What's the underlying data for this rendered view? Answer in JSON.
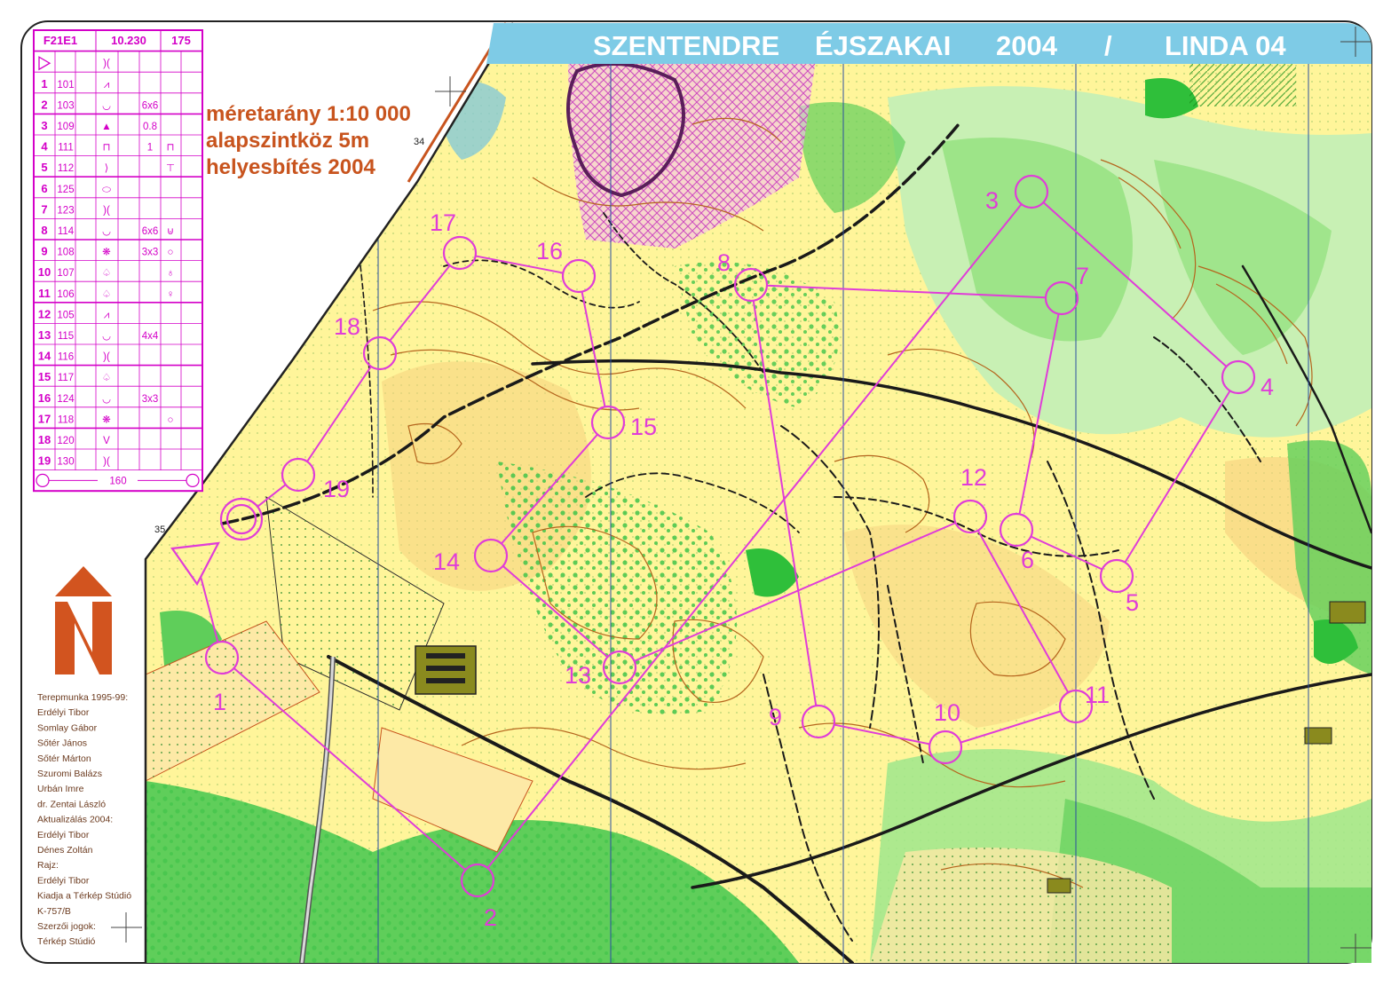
{
  "title": {
    "parts": [
      "SZENTENDRE",
      "ÉJSZAKAI",
      "2004",
      "/",
      "LINDA 04"
    ]
  },
  "map_info": {
    "scale": "méretarány 1:10 000",
    "contour": "alapszintköz 5m",
    "revision": "helyesbítés 2004"
  },
  "grid_labels": {
    "top": "34",
    "left": "35"
  },
  "colors": {
    "course": "#e03cd8",
    "title_bar": "#7ecbe6",
    "info_text": "#c8541e",
    "open_land": "#fff59a",
    "forest_green": "#5fce5a",
    "contour": "#b5651d",
    "north_arrow": "#d2541f"
  },
  "control_descriptions": {
    "header": [
      "F21E1",
      "10.230",
      "175"
    ],
    "start_symbol": "start-triangle",
    "start_feature": ")(",
    "rows": [
      {
        "num": "1",
        "code": "101",
        "feature": "⩘",
        "dim": "",
        "extra": ""
      },
      {
        "num": "2",
        "code": "103",
        "feature": "◡",
        "dim": "6x6",
        "extra": ""
      },
      {
        "num": "3",
        "code": "109",
        "feature": "▲",
        "dim": "0.8",
        "extra": ""
      },
      {
        "num": "4",
        "code": "111",
        "feature": "⊓",
        "dim": "1",
        "extra": "⊓"
      },
      {
        "num": "5",
        "code": "112",
        "feature": "⟩",
        "dim": "",
        "extra": "⊤"
      },
      {
        "num": "6",
        "code": "125",
        "feature": "⬭",
        "dim": "",
        "extra": ""
      },
      {
        "num": "7",
        "code": "123",
        "feature": ")(",
        "dim": "",
        "extra": ""
      },
      {
        "num": "8",
        "code": "114",
        "feature": "◡",
        "dim": "6x6",
        "extra": "⊍"
      },
      {
        "num": "9",
        "code": "108",
        "feature": "❋",
        "dim": "3x3",
        "extra": "○"
      },
      {
        "num": "10",
        "code": "107",
        "feature": "♤",
        "dim": "",
        "extra": "♁"
      },
      {
        "num": "11",
        "code": "106",
        "feature": "♤",
        "dim": "",
        "extra": "♀"
      },
      {
        "num": "12",
        "code": "105",
        "feature": "⩘",
        "dim": "",
        "extra": ""
      },
      {
        "num": "13",
        "code": "115",
        "feature": "◡",
        "dim": "4x4",
        "extra": ""
      },
      {
        "num": "14",
        "code": "116",
        "feature": ")(",
        "dim": "",
        "extra": ""
      },
      {
        "num": "15",
        "code": "117",
        "feature": "♤",
        "dim": "",
        "extra": ""
      },
      {
        "num": "16",
        "code": "124",
        "feature": "◡",
        "dim": "3x3",
        "extra": ""
      },
      {
        "num": "17",
        "code": "118",
        "feature": "❋",
        "dim": "",
        "extra": "○"
      },
      {
        "num": "18",
        "code": "120",
        "feature": "V",
        "dim": "",
        "extra": ""
      },
      {
        "num": "19",
        "code": "130",
        "feature": ")(",
        "dim": "",
        "extra": ""
      }
    ],
    "finish_distance": "160"
  },
  "credits": [
    "Terepmunka 1995-99:",
    "Erdélyi Tibor",
    "Somlay Gábor",
    "Sőtér János",
    "Sőtér Márton",
    "Szuromi Balázs",
    "Urbán Imre",
    "dr. Zentai László",
    "Aktualizálás 2004:",
    "Erdélyi Tibor",
    "Dénes Zoltán",
    "Rajz:",
    "Erdélyi Tibor",
    "Kiadja a Térkép Stúdió",
    "K-757/B",
    "Szerzői jogok:",
    "Térkép Stúdió"
  ],
  "course": {
    "start": {
      "label": "start"
    },
    "finish": {
      "label": "finish"
    },
    "controls": [
      {
        "n": "1",
        "label": "1"
      },
      {
        "n": "2",
        "label": "2"
      },
      {
        "n": "3",
        "label": "3"
      },
      {
        "n": "4",
        "label": "4"
      },
      {
        "n": "5",
        "label": "5"
      },
      {
        "n": "6",
        "label": "6"
      },
      {
        "n": "7",
        "label": "7"
      },
      {
        "n": "8",
        "label": "8"
      },
      {
        "n": "9",
        "label": "9"
      },
      {
        "n": "10",
        "label": "10"
      },
      {
        "n": "11",
        "label": "11"
      },
      {
        "n": "12",
        "label": "12"
      },
      {
        "n": "13",
        "label": "13"
      },
      {
        "n": "14",
        "label": "14"
      },
      {
        "n": "15",
        "label": "15"
      },
      {
        "n": "16",
        "label": "16"
      },
      {
        "n": "17",
        "label": "17"
      },
      {
        "n": "18",
        "label": "18"
      },
      {
        "n": "19",
        "label": "19"
      }
    ]
  }
}
